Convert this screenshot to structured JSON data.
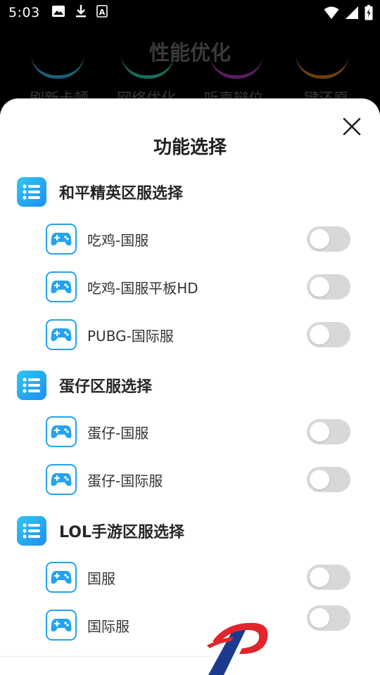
{
  "status_bar": {
    "time": "5:03",
    "left_icons": [
      "image-icon",
      "download-icon",
      "a-icon"
    ],
    "right_icons": [
      "wifi-icon",
      "signal-icon",
      "battery-icon"
    ]
  },
  "background": {
    "title": "性能优化",
    "arc_colors": [
      "#1c5f78",
      "#1a6b5e",
      "#5a1f5f",
      "#6b3e12"
    ],
    "labels": [
      "刷新卡顿",
      "网络优化",
      "听声辩位",
      "键还原"
    ]
  },
  "sheet": {
    "title": "功能选择",
    "close_icon": "close-icon",
    "sections": [
      {
        "label": "和平精英区服选择",
        "options": [
          {
            "label": "吃鸡-国服",
            "enabled": false
          },
          {
            "label": "吃鸡-国服平板HD",
            "enabled": false
          },
          {
            "label": "PUBG-国际服",
            "enabled": false
          }
        ]
      },
      {
        "label": "蛋仔区服选择",
        "options": [
          {
            "label": "蛋仔-国服",
            "enabled": false
          },
          {
            "label": "蛋仔-国际服",
            "enabled": false
          }
        ]
      },
      {
        "label": "LOL手游区服选择",
        "options": [
          {
            "label": "国服",
            "enabled": false
          },
          {
            "label": "国际服",
            "enabled": false
          }
        ]
      }
    ]
  },
  "colors": {
    "accent": "#23a3f0",
    "section_gradient_start": "#2fc7ee",
    "section_gradient_end": "#1e8ff2",
    "toggle_off": "#d8d8d8",
    "watermark_red": "#e0262b",
    "watermark_blue": "#1c3b8f"
  }
}
